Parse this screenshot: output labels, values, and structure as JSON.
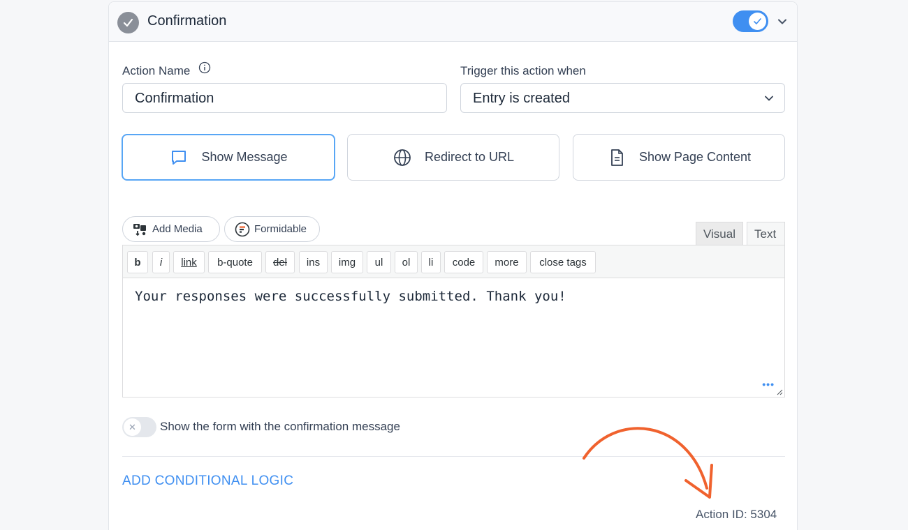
{
  "header": {
    "title": "Confirmation",
    "enabled": true
  },
  "fields": {
    "action_name_label": "Action Name",
    "action_name_value": "Confirmation",
    "trigger_label": "Trigger this action when",
    "trigger_value": "Entry is created"
  },
  "choices": [
    {
      "label": "Show Message",
      "icon": "message-icon",
      "selected": true
    },
    {
      "label": "Redirect to URL",
      "icon": "globe-icon",
      "selected": false
    },
    {
      "label": "Show Page Content",
      "icon": "document-icon",
      "selected": false
    }
  ],
  "media": {
    "add_media": "Add Media",
    "formidable": "Formidable"
  },
  "editor_tabs": {
    "visual": "Visual",
    "text": "Text",
    "active": "Text"
  },
  "quicktags": [
    "b",
    "i",
    "link",
    "b-quote",
    "del",
    "ins",
    "img",
    "ul",
    "ol",
    "li",
    "code",
    "more",
    "close tags"
  ],
  "editor_content": "Your responses were successfully submitted. Thank you!",
  "show_form_toggle": {
    "label": "Show the form with the confirmation message",
    "enabled": false
  },
  "conditional_logic_link": "ADD CONDITIONAL LOGIC",
  "action_id": "Action ID: 5304",
  "colors": {
    "accent": "#3f8ff1",
    "annotation_arrow": "#f0622e"
  }
}
